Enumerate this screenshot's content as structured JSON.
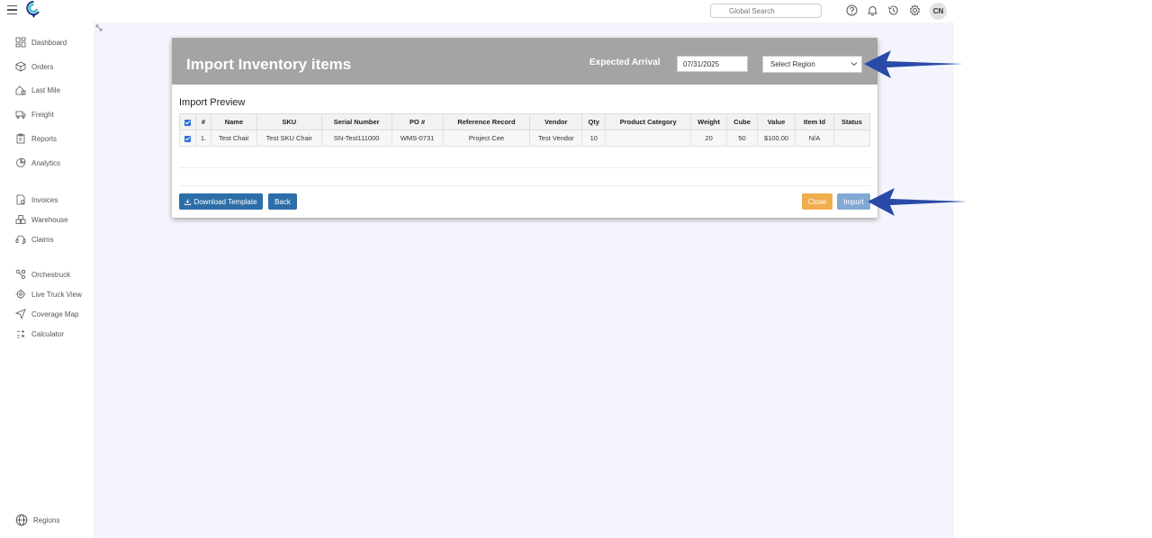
{
  "topbar": {
    "search_placeholder": "Global Search",
    "avatar_initials": "CN",
    "icons": [
      "help-icon",
      "bell-icon",
      "history-icon",
      "gear-icon"
    ]
  },
  "sidebar": {
    "groups": [
      [
        "Dashboard",
        "Orders",
        "Last Mile",
        "Freight",
        "Reports",
        "Analytics"
      ],
      [
        "Invoices",
        "Warehouse",
        "Claims"
      ],
      [
        "Orchestruck",
        "Live Truck View",
        "Coverage Map",
        "Calculator"
      ]
    ],
    "bottom_item": "Regions"
  },
  "modal": {
    "title": "Import Inventory items",
    "arrival_label": "Expected Arrival",
    "arrival_value": "07/31/2025",
    "region_selected": "Select Region",
    "preview_title": "Import Preview",
    "columns": [
      "",
      "#",
      "Name",
      "SKU",
      "Serial Number",
      "PO #",
      "Reference Record",
      "Vendor",
      "Qty",
      "Product Category",
      "Weight",
      "Cube",
      "Value",
      "Item Id",
      "Status"
    ],
    "rows": [
      {
        "checked": true,
        "num": "1.",
        "name": "Test Chair",
        "sku": "Test SKU Chair",
        "serial": "SN-Test111000",
        "po": "WMS-0731",
        "reference": "Project Cee",
        "vendor": "Test Vendor",
        "qty": "10",
        "category": "",
        "weight": "20",
        "cube": "50",
        "value": "$100.00",
        "item_id": "N/A",
        "status": ""
      }
    ],
    "buttons": {
      "download": "Download Template",
      "back": "Back",
      "close": "Close",
      "import": "Import"
    }
  },
  "colors": {
    "header_bg": "#a4a4a4",
    "primary": "#2d6ea8",
    "close": "#efad4d",
    "import_disabled": "#82a9d4",
    "annotation_arrow": "#2a4aa8"
  }
}
